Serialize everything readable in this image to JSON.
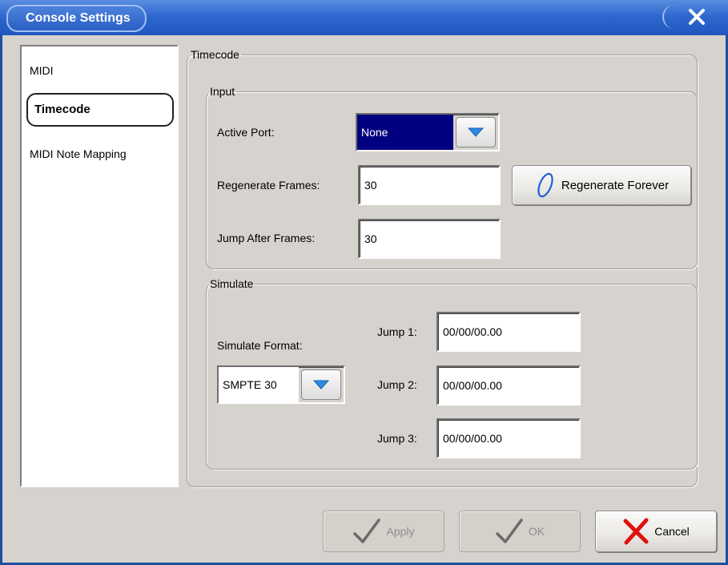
{
  "window": {
    "title": "Console Settings"
  },
  "sidebar": {
    "items": [
      {
        "label": "MIDI",
        "selected": false
      },
      {
        "label": "Timecode",
        "selected": true
      },
      {
        "label": "MIDI Note Mapping",
        "selected": false
      }
    ]
  },
  "timecode": {
    "legend": "Timecode",
    "input": {
      "legend": "Input",
      "active_port_label": "Active Port:",
      "active_port_value": "None",
      "regenerate_frames_label": "Regenerate Frames:",
      "regenerate_frames_value": "30",
      "regenerate_forever_label": "Regenerate Forever",
      "jump_after_frames_label": "Jump After Frames:",
      "jump_after_frames_value": "30"
    },
    "simulate": {
      "legend": "Simulate",
      "format_label": "Simulate Format:",
      "format_value": "SMPTE 30",
      "jump1_label": "Jump 1:",
      "jump1_value": "00/00/00.00",
      "jump2_label": "Jump 2:",
      "jump2_value": "00/00/00.00",
      "jump3_label": "Jump 3:",
      "jump3_value": "00/00/00.00"
    }
  },
  "footer": {
    "apply_label": "Apply",
    "ok_label": "OK",
    "cancel_label": "Cancel"
  },
  "colors": {
    "titlebar": "#2f68cf",
    "selected_combo": "#000080",
    "cancel_icon": "#e01010",
    "check_icon": "#555555"
  }
}
